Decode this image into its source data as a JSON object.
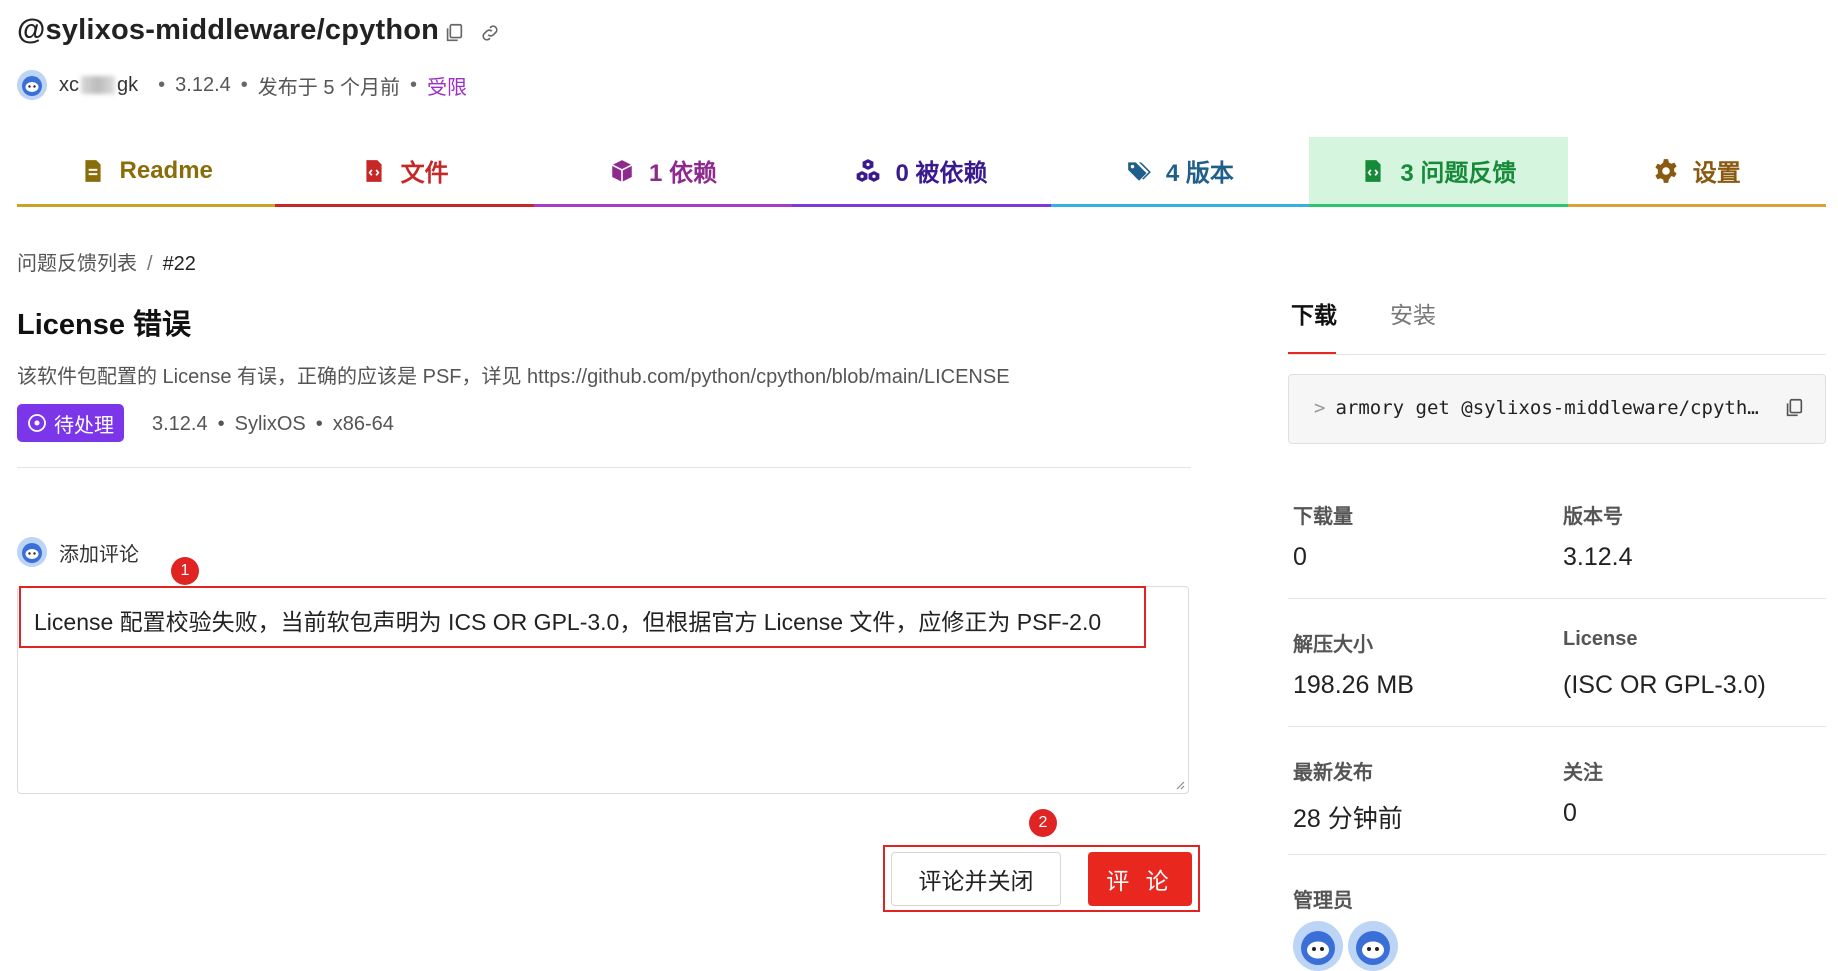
{
  "header": {
    "package_name": "@sylixos-middleware/cpython",
    "author_prefix": "xc",
    "author_suffix": "gk",
    "version": "3.12.4",
    "published": "发布于 5 个月前",
    "access": "受限"
  },
  "tabs": [
    {
      "label": "Readme",
      "color": "#8a6d0b",
      "icon": "document-icon"
    },
    {
      "label": "文件",
      "color": "#c62828",
      "icon": "code-file-icon"
    },
    {
      "label": "1 依赖",
      "color": "#8e2a8e",
      "icon": "box-icon"
    },
    {
      "label": "0 被依赖",
      "color": "#3a1a8e",
      "icon": "cubes-icon"
    },
    {
      "label": "4 版本",
      "color": "#1f5f8a",
      "icon": "tags-icon"
    },
    {
      "label": "3 问题反馈",
      "color": "#178a3a",
      "icon": "code-file-icon"
    },
    {
      "label": "设置",
      "color": "#8a5a10",
      "icon": "gear-icon"
    }
  ],
  "tab_borders": [
    "#c9a227",
    "#c62828",
    "#a93bc9",
    "#7b3ad9",
    "#3ab0e0",
    "#2fc56a",
    "#d9a23a"
  ],
  "breadcrumb": {
    "parent": "问题反馈列表",
    "separator": "/",
    "current": "#22"
  },
  "issue": {
    "title": "License 错误",
    "description": "该软件包配置的 License 有误，正确的应该是 PSF，详见 https://github.com/python/cpython/blob/main/LICENSE",
    "status": "待处理",
    "version": "3.12.4",
    "os": "SylixOS",
    "arch": "x86-64"
  },
  "comment": {
    "header": "添加评论",
    "text": "License 配置校验失败，当前软包声明为 ICS OR GPL-3.0，但根据官方 License 文件，应修正为 PSF-2.0",
    "close_button": "评论并关闭",
    "submit_button": "评 论",
    "markers": [
      "1",
      "2"
    ]
  },
  "sidebar": {
    "tab_download": "下载",
    "tab_install": "安装",
    "command_prompt": ">",
    "command": "armory get @sylixos-middleware/cpyth…",
    "stats": [
      {
        "label": "下载量",
        "value": "0"
      },
      {
        "label": "版本号",
        "value": "3.12.4"
      },
      {
        "label": "解压大小",
        "value": "198.26 MB"
      },
      {
        "label": "License",
        "value": "(ISC OR GPL-3.0)"
      },
      {
        "label": "最新发布",
        "value": "28 分钟前"
      },
      {
        "label": "关注",
        "value": "0"
      }
    ],
    "admins_label": "管理员"
  },
  "colors": {
    "accent_red": "#e8281e",
    "status_purple": "#7b36ea",
    "active_tab_bg": "#d5f5df"
  }
}
